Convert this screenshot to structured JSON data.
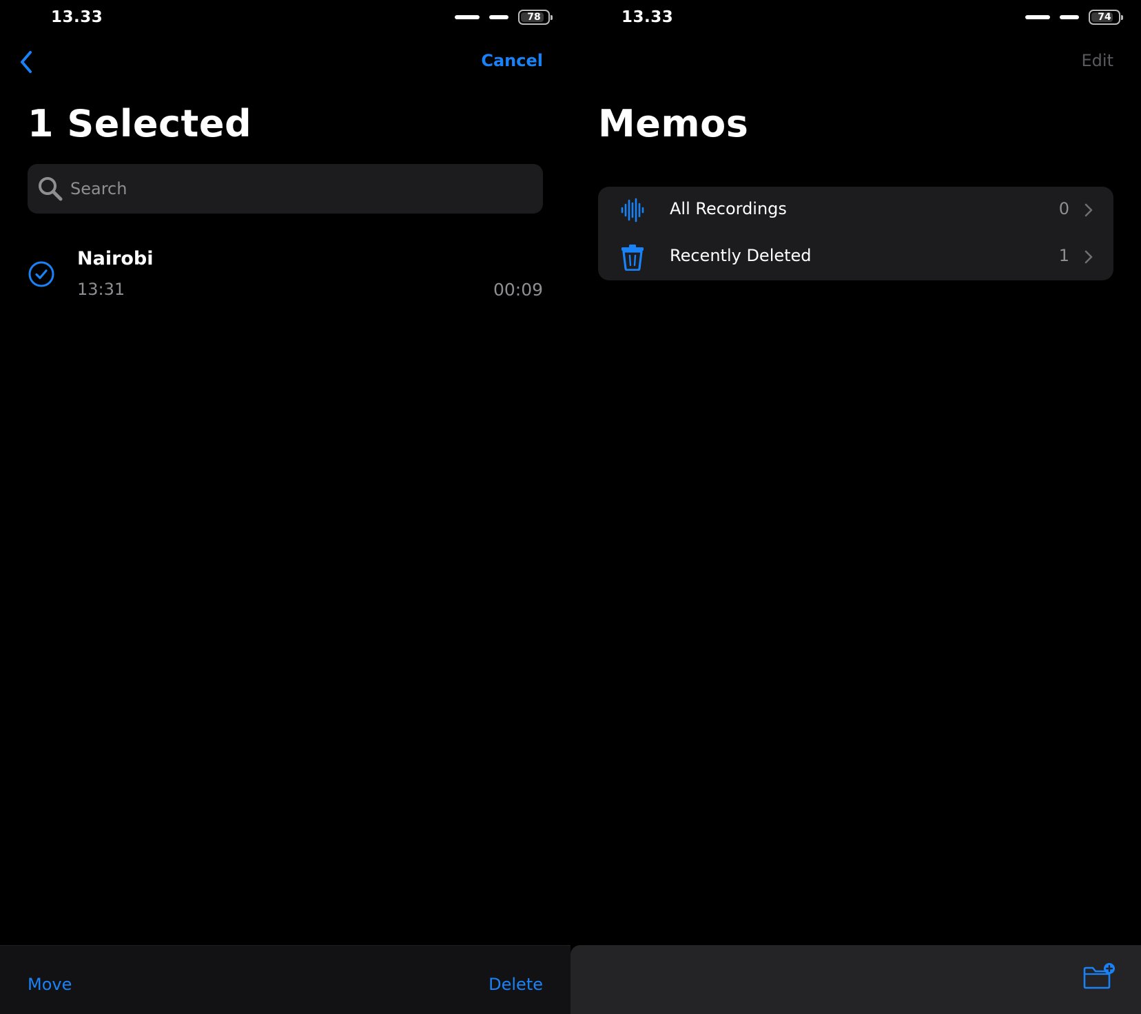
{
  "left_screen": {
    "status_bar": {
      "time": "13.33",
      "battery": "78"
    },
    "nav": {
      "cancel_label": "Cancel"
    },
    "title": "1 Selected",
    "search": {
      "placeholder": "Search"
    },
    "recordings": [
      {
        "title": "Nairobi",
        "time": "13:31",
        "duration": "00:09",
        "selected": true
      }
    ],
    "toolbar": {
      "move_label": "Move",
      "delete_label": "Delete"
    }
  },
  "right_screen": {
    "status_bar": {
      "time": "13.33",
      "battery": "74"
    },
    "nav": {
      "edit_label": "Edit"
    },
    "title": "Memos",
    "folders": [
      {
        "label": "All Recordings",
        "count": "0",
        "icon": "waveform-icon"
      },
      {
        "label": "Recently Deleted",
        "count": "1",
        "icon": "trash-icon"
      }
    ],
    "toolbar": {
      "new_folder_icon": "folder-plus-icon"
    }
  },
  "colors": {
    "accent": "#1a82f7",
    "background": "#000000",
    "card": "#1c1c1e",
    "secondary_text": "#8e8e93"
  }
}
